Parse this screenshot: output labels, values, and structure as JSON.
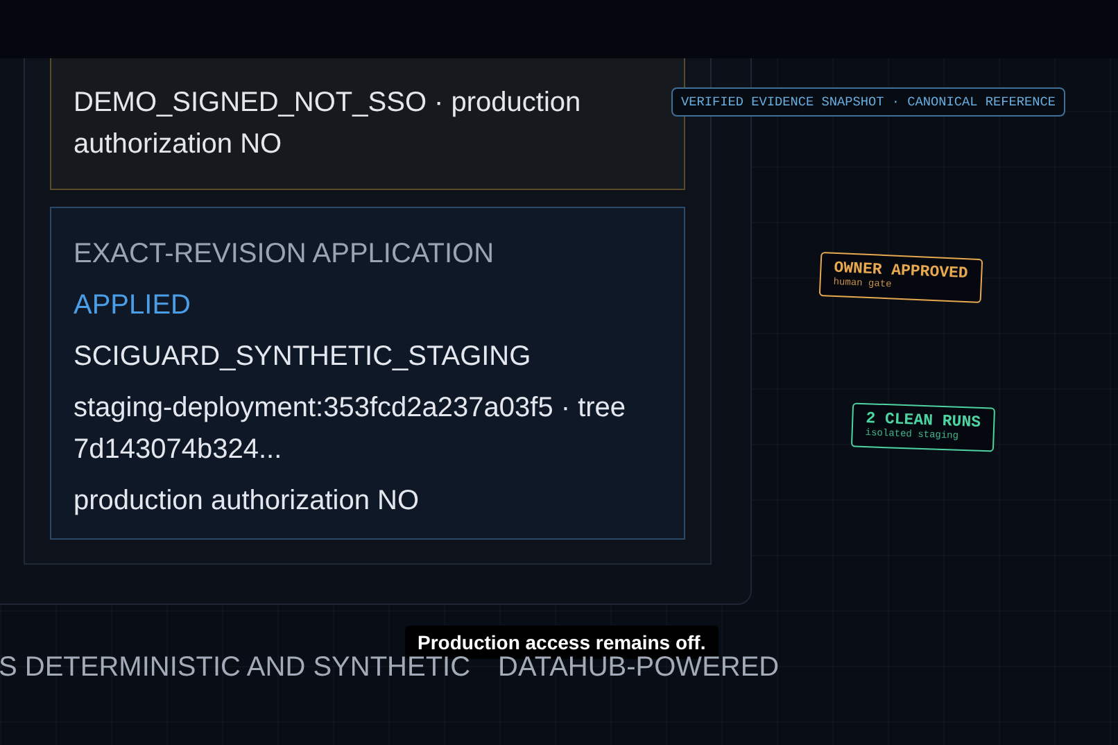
{
  "identity_card": {
    "lines": [
      "DEMO_SIGNED_NOT_SSO · production authorization NO"
    ]
  },
  "application_card": {
    "heading": "EXACT-REVISION APPLICATION",
    "status": "APPLIED",
    "lines": [
      "SCIGUARD_SYNTHETIC_STAGING",
      "staging-deployment:353fcd2a237a03f5 · tree 7d143074b324...",
      "production authorization NO"
    ]
  },
  "snapshot_badge": "VERIFIED EVIDENCE SNAPSHOT · CANONICAL REFERENCE",
  "stamps": [
    {
      "title": "OWNER APPROVED",
      "subtitle": "human gate",
      "color": "#e8a850"
    },
    {
      "title": "2 CLEAN RUNS",
      "subtitle": "isolated staging",
      "color": "#4ed3a2"
    }
  ],
  "tooltip": "Production access remains off.",
  "ticker": [
    "S DETERMINISTIC AND SYNTHETIC",
    "DATAHUB-POWERED"
  ]
}
